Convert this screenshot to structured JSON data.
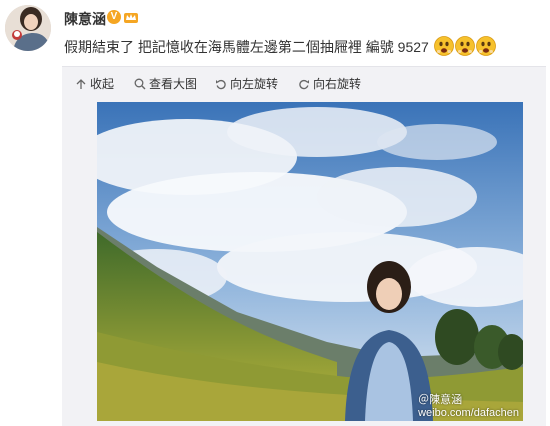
{
  "post": {
    "username": "陳意涵",
    "verified_badge": "V",
    "text": "假期結束了 把記憶收在海馬體左邊第二個抽屜裡 編號 9527",
    "emoji_count": 3
  },
  "toolbar": {
    "collapse_label": "收起",
    "view_large_label": "查看大图",
    "rotate_left_label": "向左旋转",
    "rotate_right_label": "向右旋转"
  },
  "photo": {
    "watermark": "＠陳意涵\nweibo.com/dafachen",
    "watermark_line1": "＠陳意涵",
    "watermark_line2": "weibo.com/dafachen"
  },
  "colors": {
    "badge": "#f5a623",
    "media_background": "#f2f2f5",
    "emoji": "#f6c12c"
  },
  "icons": [
    "arrow-up-icon",
    "search-icon",
    "rotate-left-icon",
    "rotate-right-icon",
    "verified-icon",
    "crown-icon",
    "worried-face-emoji-icon"
  ]
}
